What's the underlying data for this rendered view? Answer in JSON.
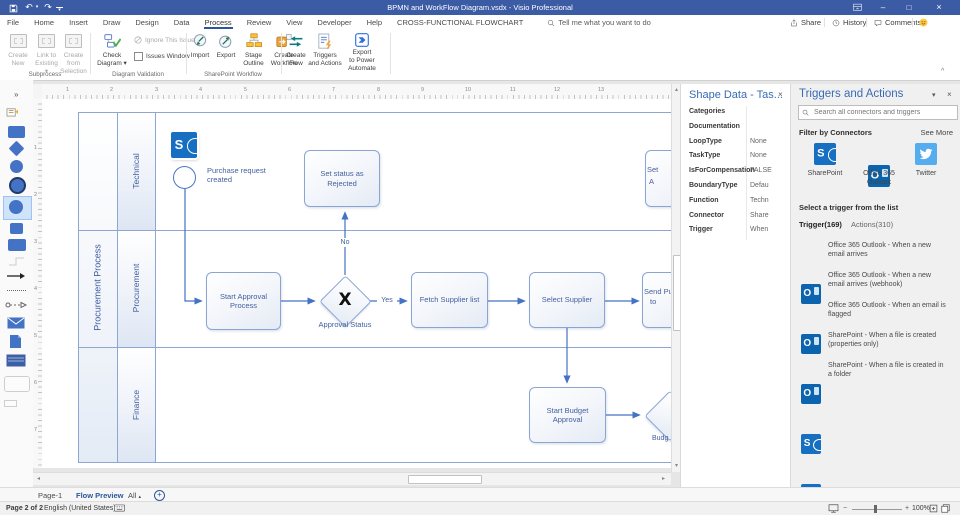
{
  "titlebar": {
    "title": "BPMN and WorkFlow Diagram.vsdx - Visio Professional"
  },
  "glyphs": {
    "close": "×",
    "dropdown": "▾",
    "up_small": "▴",
    "minimize": "–",
    "maximize": "□",
    "undo": "↶",
    "redo": "↷",
    "ribbon_collapse": "^",
    "shapes_expand": "»",
    "scroll_up": "▴",
    "scroll_down": "▾",
    "scroll_left": "◂",
    "scroll_right": "▸",
    "minus": "−",
    "plus": "+"
  },
  "tabs": {
    "items": [
      "File",
      "Home",
      "Insert",
      "Draw",
      "Design",
      "Data",
      "Process",
      "Review",
      "View",
      "Developer",
      "Help",
      "CROSS-FUNCTIONAL FLOWCHART"
    ],
    "active": "Process",
    "tell_me": "Tell me what you want to do",
    "share": "Share",
    "history": "History",
    "comments": "Comments"
  },
  "ribbon": {
    "groups": [
      {
        "label": "Subprocess"
      },
      {
        "label": "Diagram Validation"
      },
      {
        "label": "SharePoint Workflow"
      },
      {
        "label": ""
      }
    ],
    "buttons": {
      "create_new": "Create\nNew",
      "link_existing": "Link to\nExisting ▾",
      "create_from_selection": "Create from\nSelection",
      "check_diagram": "Check\nDiagram ▾",
      "ignore_issue": "Ignore This Issue ▾",
      "issues_window": "Issues Window",
      "import": "Import",
      "export": "Export",
      "stage_outline": "Stage\nOutline",
      "create_workflow": "Create\nWorkflow",
      "create_flow": "Create\nFlow",
      "triggers_actions": "Triggers\nand Actions",
      "export_power": "Export\nto Power\nAutomate"
    }
  },
  "ruler": {
    "h": [
      "1",
      "2",
      "3",
      "4",
      "5",
      "6",
      "7",
      "8",
      "9",
      "10",
      "11",
      "12",
      "13"
    ],
    "v": [
      "1",
      "2",
      "3",
      "4",
      "5",
      "6",
      "7"
    ]
  },
  "flowchart": {
    "title": "Procurement Process",
    "lanes": [
      "Technical",
      "Procurement",
      "Finance"
    ],
    "nodes": {
      "start_event_label": "Purchase request created",
      "set_rejected": "Set status as Rejected",
      "start_approval": "Start Approval Process",
      "gateway_mark": "X",
      "gateway_label": "Approval Status",
      "fetch_supplier": "Fetch Supplier list",
      "select_supplier": "Select Supplier",
      "start_budget": "Start Budget Approval",
      "send_po_line1": "Send Pu",
      "send_po_line2": "to",
      "set_approved_line1": "Set",
      "set_approved_line2": "A",
      "budget_partial": "Budg"
    },
    "labels": {
      "no": "No",
      "yes": "Yes"
    }
  },
  "shape_data": {
    "title": "Shape Data - Tas...",
    "rows": [
      {
        "name": "Categories",
        "value": ""
      },
      {
        "name": "Documentation",
        "value": ""
      },
      {
        "name": "LoopType",
        "value": "None"
      },
      {
        "name": "TaskType",
        "value": "None"
      },
      {
        "name": "IsForCompensation",
        "value": "FALSE"
      },
      {
        "name": "BoundaryType",
        "value": "Defau"
      },
      {
        "name": "Function",
        "value": "Techn"
      },
      {
        "name": "Connector",
        "value": "Share"
      },
      {
        "name": "Trigger",
        "value": "When"
      }
    ]
  },
  "triggers_panel": {
    "title": "Triggers and Actions",
    "search_placeholder": "Search all connectors and triggers",
    "filter_label": "Filter by Connectors",
    "see_more": "See More",
    "connectors": [
      "SharePoint",
      "Office 365 Outlook",
      "Twitter"
    ],
    "select_label": "Select a trigger from the list",
    "trigger_tab": "Trigger(169)",
    "actions_tab": "Actions(310)",
    "items": [
      {
        "connector": "outlook",
        "text": "Office 365 Outlook - When a new email arrives"
      },
      {
        "connector": "outlook",
        "text": "Office 365 Outlook - When a new email arrives (webhook)"
      },
      {
        "connector": "outlook",
        "text": "Office 365 Outlook - When an email is flagged"
      },
      {
        "connector": "sharepoint",
        "text": "SharePoint - When a file is created (properties only)"
      },
      {
        "connector": "sharepoint",
        "text": "SharePoint - When a file is created in a folder"
      }
    ]
  },
  "page_tabs": {
    "page1": "Page-1",
    "active": "Flow Preview",
    "all": "All"
  },
  "status_bar": {
    "page_info": "Page 2 of 2",
    "language": "English (United States)",
    "zoom": "100%"
  },
  "colors": {
    "titlebar": "#3b5ba5",
    "accent": "#2b579a",
    "diagram_blue": "#4472c4",
    "sharepoint": "#176fc1",
    "outlook": "#0b64ad",
    "twitter": "#55acee"
  }
}
